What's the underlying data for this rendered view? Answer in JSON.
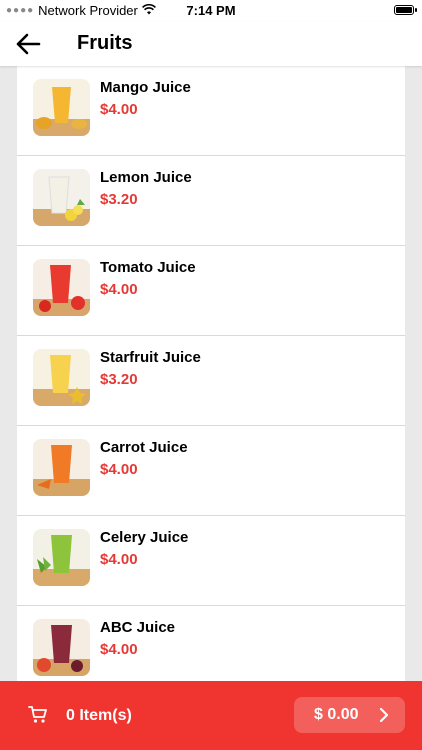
{
  "status_bar": {
    "carrier": "Network Provider",
    "time": "7:14 PM"
  },
  "nav": {
    "title": "Fruits"
  },
  "products": [
    {
      "name": "Mango Juice",
      "price": "$4.00"
    },
    {
      "name": "Lemon Juice",
      "price": "$3.20"
    },
    {
      "name": "Tomato Juice",
      "price": "$4.00"
    },
    {
      "name": "Starfruit Juice",
      "price": "$3.20"
    },
    {
      "name": "Carrot Juice",
      "price": "$4.00"
    },
    {
      "name": "Celery Juice",
      "price": "$4.00"
    },
    {
      "name": "ABC Juice",
      "price": "$4.00"
    }
  ],
  "cart": {
    "count_label": "0 Item(s)",
    "total": "$ 0.00"
  },
  "colors": {
    "accent": "#f0342f",
    "price": "#e53935"
  },
  "icons": {
    "back": "arrow-left-icon",
    "cart": "cart-icon",
    "next": "chevron-right-icon",
    "wifi": "wifi-icon",
    "battery": "battery-icon"
  }
}
